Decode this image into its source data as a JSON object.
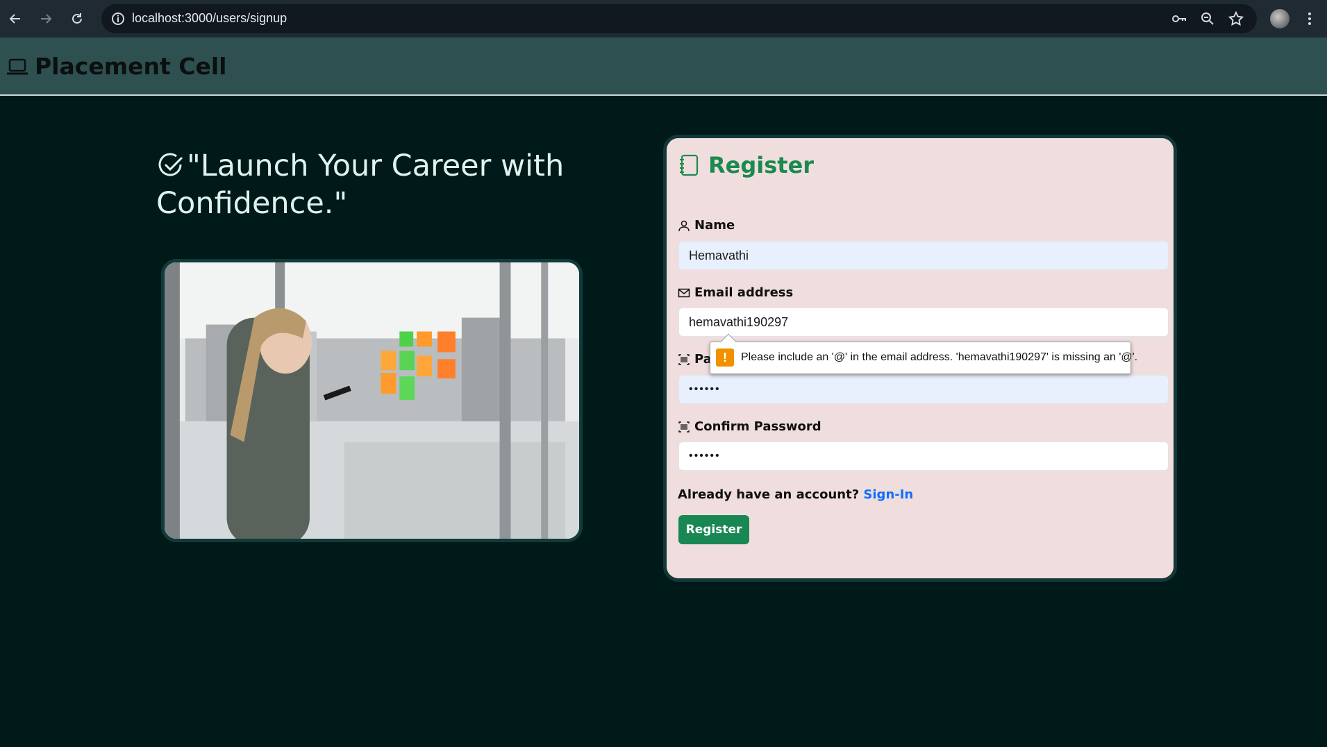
{
  "browser": {
    "url": "localhost:3000/users/signup"
  },
  "navbar": {
    "brand": "Placement Cell",
    "brand_icon": "laptop-icon"
  },
  "hero": {
    "quote": "\"Launch Your Career with Confidence.\"",
    "icon": "check-circle-icon"
  },
  "register": {
    "title": "Register",
    "title_icon": "journal-icon",
    "name_label": "Name",
    "name_value": "Hemavathi",
    "email_label": "Email address",
    "email_value": "hemavathi190297",
    "password_label": "Pas",
    "password_value": "••••••",
    "confirm_label": "Confirm Password",
    "confirm_value": "••••••",
    "account_text": "Already have an account?",
    "signin_link": "Sign-In",
    "button_label": "Register",
    "accent_color": "#198754",
    "link_color": "#0d6efd"
  },
  "validation": {
    "message": "Please include an '@' in the email address. 'hemavathi190297' is missing an '@'."
  }
}
